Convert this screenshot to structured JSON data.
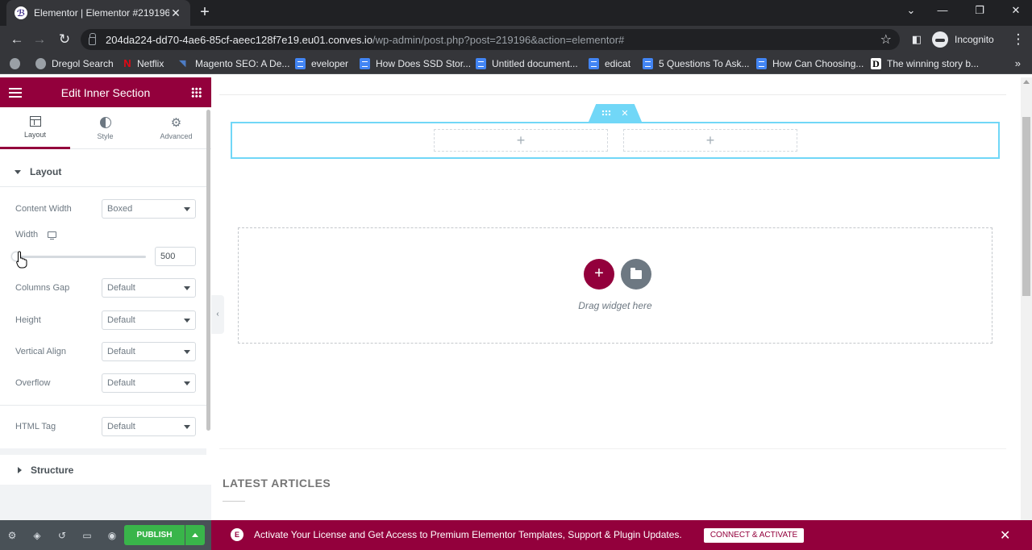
{
  "browser": {
    "tab_title": "Elementor | Elementor #219196",
    "tab_close": "✕",
    "new_tab": "+",
    "url_host": "204da224-dd70-4ae6-85cf-aeec128f7e19.eu01.conves.io",
    "url_path": "/wp-admin/post.php?post=219196&action=elementor#",
    "profile_label": "Incognito",
    "bookmarks": [
      "Dregol Search",
      "Netflix",
      "Magento SEO: A De...",
      "eveloper",
      "How Does SSD Stor...",
      "Untitled document...",
      "edicat",
      "5 Questions To Ask...",
      "How Can Choosing...",
      "The winning story b..."
    ],
    "bookmarks_more": "»"
  },
  "panel": {
    "title": "Edit Inner Section",
    "tabs": {
      "layout": "Layout",
      "style": "Style",
      "advanced": "Advanced"
    },
    "layout_section": "Layout",
    "controls": {
      "content_width_label": "Content Width",
      "content_width_value": "Boxed",
      "width_label": "Width",
      "width_value": "500",
      "width_slider_fraction": 0.0,
      "columns_gap_label": "Columns Gap",
      "columns_gap_value": "Default",
      "height_label": "Height",
      "height_value": "Default",
      "vertical_align_label": "Vertical Align",
      "vertical_align_value": "Default",
      "overflow_label": "Overflow",
      "overflow_value": "Default",
      "html_tag_label": "HTML Tag",
      "html_tag_value": "Default"
    },
    "structure_section": "Structure",
    "publish_label": "PUBLISH"
  },
  "canvas": {
    "column_add": "+",
    "add_button": "+",
    "drag_text": "Drag widget here",
    "latest_title": "LATEST ARTICLES",
    "inner_section_close": "✕"
  },
  "notice": {
    "icon_letter": "E",
    "text": "Activate Your License and Get Access to Premium Elementor Templates, Support & Plugin Updates.",
    "button": "CONNECT & ACTIVATE",
    "close": "✕"
  },
  "colors": {
    "brand": "#93003c",
    "publish_green": "#39b54a",
    "section_cyan": "#71d7f7"
  }
}
